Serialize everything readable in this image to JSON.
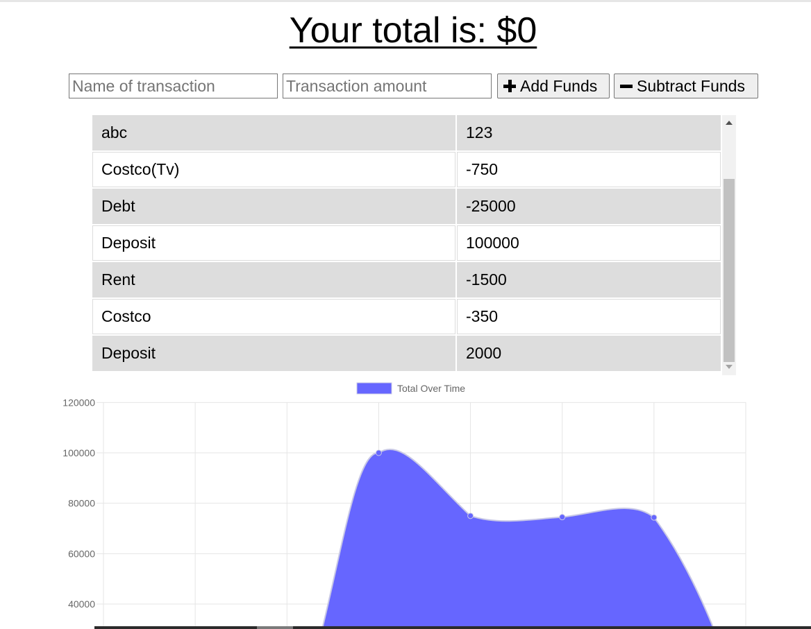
{
  "header": {
    "title": "Your total is: $0"
  },
  "form": {
    "name_placeholder": "Name of transaction",
    "amount_placeholder": "Transaction amount",
    "add_label": "Add Funds",
    "subtract_label": "Subtract Funds",
    "add_icon": "plus-icon",
    "subtract_icon": "minus-icon"
  },
  "transactions": [
    {
      "name": "abc",
      "amount": "123"
    },
    {
      "name": "Costco(Tv)",
      "amount": "-750"
    },
    {
      "name": "Debt",
      "amount": "-25000"
    },
    {
      "name": "Deposit",
      "amount": "100000"
    },
    {
      "name": "Rent",
      "amount": "-1500"
    },
    {
      "name": "Costco",
      "amount": "-350"
    },
    {
      "name": "Deposit",
      "amount": "2000"
    }
  ],
  "colors": {
    "row_alt": "#dddddd",
    "chart_fill": "#6666ff",
    "chart_line": "#c8c8e6"
  },
  "chart_data": {
    "type": "area",
    "legend": "Total Over Time",
    "legend_position": "top-center",
    "grid": true,
    "series": [
      {
        "name": "Total Over Time",
        "values": [
          null,
          null,
          null,
          100000,
          75000,
          74500,
          74350
        ]
      }
    ],
    "x_count": 8,
    "y_ticks": [
      120000,
      100000,
      80000,
      60000,
      40000
    ],
    "ylim": [
      40000,
      120000
    ],
    "fill": "#6666ff"
  }
}
